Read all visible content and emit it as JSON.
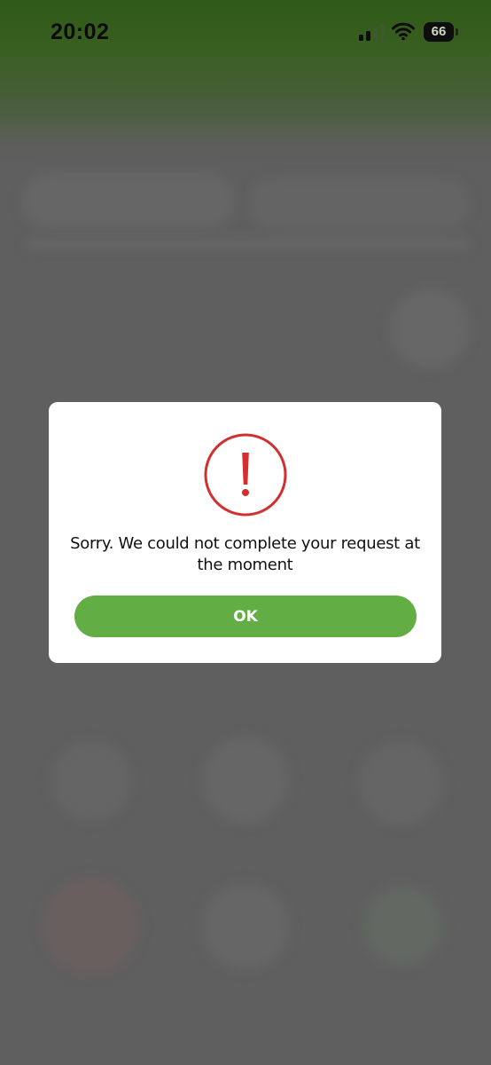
{
  "status_bar": {
    "time": "20:02",
    "battery_level": "66",
    "signal_icon": "cellular-signal-icon",
    "wifi_icon": "wifi-icon",
    "battery_icon": "battery-icon"
  },
  "dialog": {
    "icon": "exclamation-circle-icon",
    "icon_color": "#d32f2f",
    "message": "Sorry. We could not complete your request at the moment",
    "ok_label": "OK",
    "ok_color": "#63ae44"
  }
}
